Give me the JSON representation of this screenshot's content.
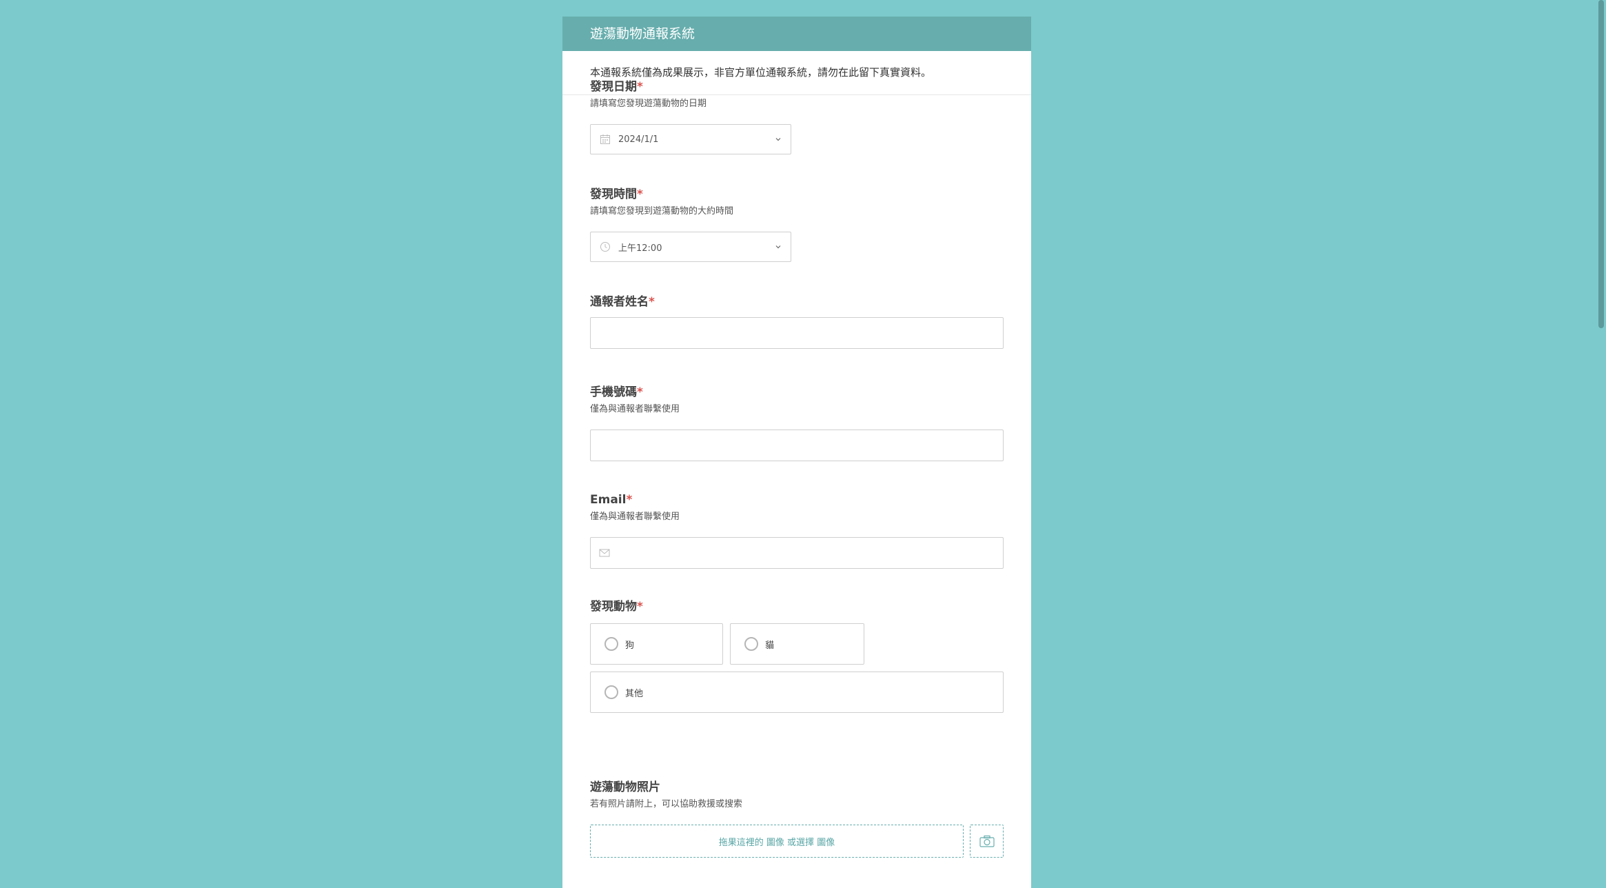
{
  "form": {
    "title": "遊蕩動物通報系統",
    "notice": "本通報系統僅為成果展示，非官方單位通報系統，請勿在此留下真實資料。",
    "required_mark": "*",
    "fields": {
      "date": {
        "label": "發現日期",
        "hint": "請填寫您發現遊蕩動物的日期",
        "value": "2024/1/1"
      },
      "time": {
        "label": "發現時間",
        "hint": "請填寫您發現到遊蕩動物的大約時間",
        "value": "上午12:00"
      },
      "name": {
        "label": "通報者姓名",
        "value": ""
      },
      "phone": {
        "label": "手機號碼",
        "hint": "僅為與通報者聯繫使用",
        "value": ""
      },
      "email": {
        "label": "Email",
        "hint": "僅為與通報者聯繫使用",
        "value": ""
      },
      "animal": {
        "label": "發現動物",
        "options": [
          "狗",
          "貓",
          "其他"
        ]
      },
      "photo": {
        "label": "遊蕩動物照片",
        "hint": "若有照片請附上，可以協助救援或搜索",
        "upload_text": "拖果這裡的 圖像 或選擇 圖像"
      }
    }
  },
  "colors": {
    "background": "#7ccacb",
    "header": "#67adad",
    "required": "#d9534f",
    "accent": "#5aa6a6"
  },
  "icons": {
    "date": "calendar-icon",
    "time": "clock-icon",
    "dropdown": "chevron-down-icon",
    "email": "envelope-icon",
    "camera": "camera-icon"
  }
}
